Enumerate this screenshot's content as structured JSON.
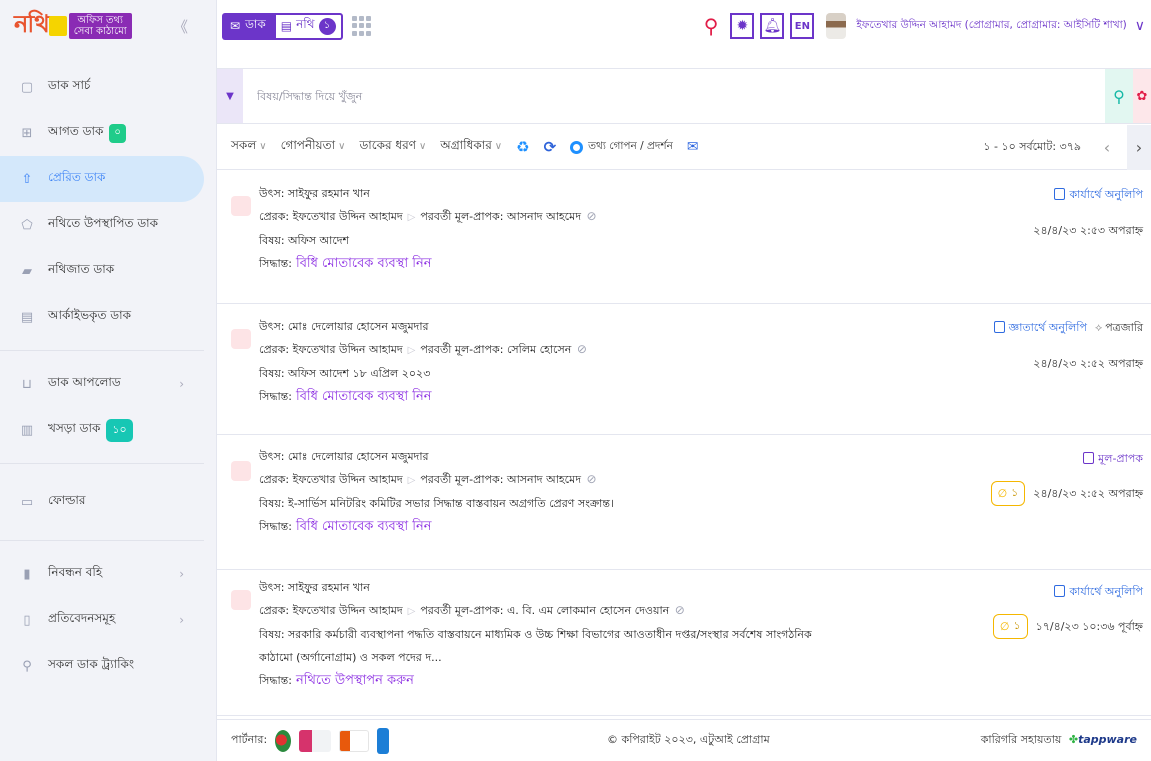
{
  "brand": {
    "logo_text": "নথি",
    "tag_line1": "অফিস তথ্য",
    "tag_line2": "সেবা কাঠামো",
    "collapse_icon": "double-chevron-left-icon"
  },
  "sidebar": {
    "items": [
      {
        "label": "ডাক সার্চ",
        "icon": "search-box-icon"
      },
      {
        "label": "আগত ডাক",
        "icon": "inbox-icon",
        "badge": "০"
      },
      {
        "label": "প্রেরিত ডাক",
        "icon": "upload-icon",
        "active": true
      },
      {
        "label": "নথিতে উপস্থাপিত ডাক",
        "icon": "tag-icon"
      },
      {
        "label": "নথিজাত ডাক",
        "icon": "folder-icon"
      },
      {
        "label": "আর্কাইভকৃত ডাক",
        "icon": "archive-icon"
      }
    ],
    "items2": [
      {
        "label": "ডাক আপলোড",
        "icon": "upload-tray-icon"
      },
      {
        "label": "খসড়া ডাক",
        "icon": "draft-icon",
        "badge": "১০"
      }
    ],
    "items3": [
      {
        "label": "ফোল্ডার",
        "icon": "folder-icon"
      }
    ],
    "items4": [
      {
        "label": "নিবন্ধন বহি",
        "icon": "book-icon"
      },
      {
        "label": "প্রতিবেদনসমূহ",
        "icon": "report-icon"
      },
      {
        "label": "সকল ডাক ট্র্যাকিং",
        "icon": "search-icon"
      }
    ]
  },
  "topbar": {
    "tab_dak": "ডাক",
    "tab_nothi": "নথি",
    "tab_nothi_count": "১",
    "lang": "EN",
    "user_name": "ইফতেখার উদ্দিন আহামদ (প্রোগ্রামার, প্রোগ্রামার: আইসিটি শাখা)"
  },
  "search": {
    "placeholder": "বিষয়/সিদ্ধান্ত দিয়ে খুঁজুন"
  },
  "filters": {
    "all": "সকল",
    "secrecy": "গোপনীয়তা",
    "dak_type": "ডাকের ধরণ",
    "priority": "অগ্রাধিকার",
    "info_toggle": "তথ্য গোপন / প্রদর্শন",
    "pager": "১ - ১০ সর্বমোট: ৩৭৯"
  },
  "labels": {
    "source": "উৎস:",
    "sender": "প্রেরক:",
    "next_receiver": "পরবর্তী মূল-প্রাপক:",
    "subject": "বিষয়:",
    "decision": "সিদ্ধান্ত:"
  },
  "dak_items": [
    {
      "source": "সাইফুর রহমান খান",
      "sender": "ইফতেখার উদ্দিন আহামদ",
      "receiver": "আসনাদ আহমেদ",
      "subject": "অফিস আদেশ",
      "decision": "বিধি মোতাবেক ব্যবস্থা নিন",
      "role": "কার্যার্থে অনুলিপি",
      "datetime": "২৪/৪/২৩ ২:৫৩ অপরাহ্ন"
    },
    {
      "source": "মোঃ দেলোয়ার হোসেন মজুমদার",
      "sender": "ইফতেখার উদ্দিন আহামদ",
      "receiver": "সেলিম হোসেন",
      "subject": "অফিস আদেশ ১৮ এপ্রিল ২০২৩",
      "decision": "বিধি মোতাবেক ব্যবস্থা নিন",
      "role": "জ্ঞাতার্থে অনুলিপি",
      "extra": "পত্রজারি",
      "datetime": "২৪/৪/২৩ ২:৫২ অপরাহ্ন"
    },
    {
      "source": "মোঃ দেলোয়ার হোসেন মজুমদার",
      "sender": "ইফতেখার উদ্দিন আহামদ",
      "receiver": "আসনাদ আহমেদ",
      "subject": "ই-সার্ভিস মনিটরিং কমিটির সভার সিদ্ধান্ত বাস্তবায়ন অগ্রগতি প্রেরণ সংক্রান্ত।",
      "decision": "বিধি মোতাবেক ব্যবস্থা নিন",
      "role": "মূল-প্রাপক",
      "attach": "১",
      "datetime": "২৪/৪/২৩ ২:৫২ অপরাহ্ন"
    },
    {
      "source": "সাইফুর রহমান খান",
      "sender": "ইফতেখার উদ্দিন আহামদ",
      "receiver": "এ. বি. এম লোকমান হোসেন দেওয়ান",
      "subject": "সরকারি কর্মচারী ব্যবস্থাপনা পদ্ধতি বাস্তবায়নে মাধ্যমিক ও উচ্চ শিক্ষা বিভাগের আওতাধীন দপ্তর/সংস্থার সর্বশেষ সাংগঠনিক কাঠামো (অর্গানোগ্রাম) ও সকল পদের দ...",
      "decision": "নথিতে উপস্থাপন করুন",
      "role": "কার্যার্থে অনুলিপি",
      "attach": "১",
      "datetime": "১৭/৪/২৩ ১০:৩৬ পূর্বাহ্ন"
    }
  ],
  "footer": {
    "partners_label": "পার্টনার:",
    "copyright": "© কপিরাইট ২০২৩, এটুআই প্রোগ্রাম",
    "support_label": "কারিগরি সহায়তায়",
    "support_brand": "tappware"
  },
  "colors": {
    "primary": "#6c35c9",
    "active_bg": "#d4e8fb",
    "search_red": "#e11d48",
    "badge_green": "#1fcc8a"
  }
}
